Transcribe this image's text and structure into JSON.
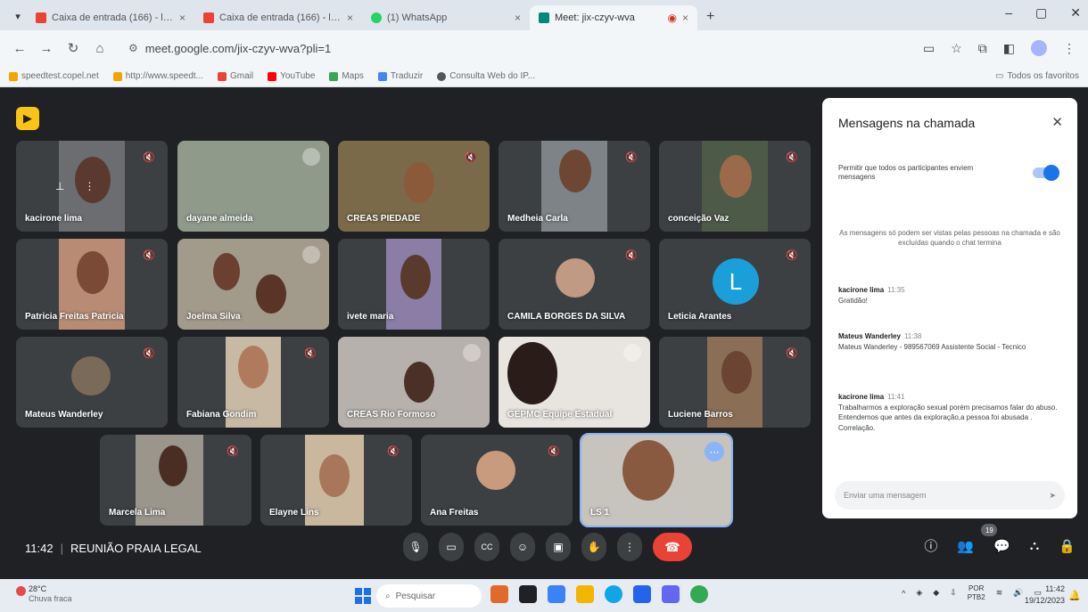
{
  "browser": {
    "tabs": [
      {
        "title": "Caixa de entrada (166) - ls1@...",
        "favicon_color": "#ea4335"
      },
      {
        "title": "Caixa de entrada (166) - ls1@...",
        "favicon_color": "#ea4335"
      },
      {
        "title": "(1) WhatsApp",
        "favicon_color": "#25d366"
      },
      {
        "title": "Meet: jix-czyv-wva",
        "favicon_color": "#00897b",
        "active": true
      }
    ],
    "url": "meet.google.com/jix-czyv-wva?pli=1",
    "bookmarks": [
      {
        "label": "speedtest.copel.net",
        "color": "#f4a300"
      },
      {
        "label": "http://www.speedt...",
        "color": "#f4a300"
      },
      {
        "label": "Gmail",
        "color": "#ea4335"
      },
      {
        "label": "YouTube",
        "color": "#ff0000"
      },
      {
        "label": "Maps",
        "color": "#34a853"
      },
      {
        "label": "Traduzir",
        "color": "#4285f4"
      },
      {
        "label": "Consulta Web do IP...",
        "color": "#555555"
      }
    ],
    "all_bookmarks": "Todos os favoritos"
  },
  "meet": {
    "participants": [
      {
        "name": "kacirone lima",
        "bg": "#6b6d70",
        "face": "#5a3a2e",
        "muted": true
      },
      {
        "name": "dayane almeida",
        "bg": "#8f9a8a",
        "face": "#b8a99a",
        "muted": true
      },
      {
        "name": "CREAS PIEDADE",
        "bg": "#7a6a4a",
        "face": "#8a5a3a",
        "muted": true
      },
      {
        "name": "Medheia Carla",
        "bg": "#7d8386",
        "face": "#6e4634",
        "muted": true
      },
      {
        "name": "conceição Vaz",
        "bg": "#4e5a48",
        "face": "#9a6a4a",
        "muted": true
      },
      {
        "name": "Patricia Freitas Patricia",
        "bg": "#b88c74",
        "face": "#7a4a36",
        "muted": true
      },
      {
        "name": "Joelma Silva",
        "bg": "#a29a8a",
        "face": "#6b4030",
        "muted": true
      },
      {
        "name": "ivete maria",
        "bg": "#8a7ea6",
        "face": "#5b3a2e",
        "muted": false
      },
      {
        "name": "CAMILA BORGES DA SILVA",
        "bg": "#3c4043",
        "face": "#c19a84",
        "muted": true
      },
      {
        "name": "Leticia Arantes",
        "bg": "#3c4043",
        "face": "",
        "muted": true,
        "initial": "L"
      },
      {
        "name": "Mateus Wanderley",
        "bg": "#3c4043",
        "face": "#7a6a5a",
        "muted": true
      },
      {
        "name": "Fabiana Gondim",
        "bg": "#c7b9a4",
        "face": "#b07a5e",
        "muted": true
      },
      {
        "name": "CREAS Rio Formoso",
        "bg": "#b6b1ad",
        "face": "#4a3026",
        "muted": false
      },
      {
        "name": "GEPMC Equipe Estadual",
        "bg": "#e8e4e0",
        "face": "#2a1c18",
        "muted": false
      },
      {
        "name": "Luciene Barros",
        "bg": "#8a6e56",
        "face": "#6b4434",
        "muted": true
      },
      {
        "name": "Marcela Lima",
        "bg": "#9a968c",
        "face": "#4a2e24",
        "muted": true
      },
      {
        "name": "Elayne Lins",
        "bg": "#c9b89e",
        "face": "#a8765a",
        "muted": true
      },
      {
        "name": "Ana Freitas",
        "bg": "#4a4d50",
        "face": "#c89a7e",
        "muted": true
      },
      {
        "name": "LS 1",
        "bg": "#c7c3bd",
        "face": "#8a5a40",
        "muted": false,
        "speaking": true
      }
    ],
    "time": "11:42",
    "meeting_name": "REUNIÃO PRAIA LEGAL",
    "participant_count": "19",
    "icons": {
      "mic": "🎙",
      "camera": "▭",
      "captions": "CC",
      "emoji": "☺",
      "present": "▣",
      "hand": "✋",
      "more": "⋮",
      "hangup": "☎",
      "info": "ⓘ",
      "people": "👥",
      "chat": "💬",
      "activities": "⛬",
      "host": "🔒",
      "muted": "🔇"
    }
  },
  "chat": {
    "title": "Mensagens na chamada",
    "permission": "Permitir que todos os participantes enviem mensagens",
    "notice": "As mensagens só podem ser vistas pelas pessoas na chamada e são excluídas quando o chat termina",
    "messages": [
      {
        "who": "kacirone lima",
        "time": "11:35",
        "text": "Gratidão!"
      },
      {
        "who": "Mateus Wanderley",
        "time": "11:38",
        "text": "Mateus Wanderley - 989567069 Assistente Social - Tecnico"
      },
      {
        "who": "kacirone lima",
        "time": "11:41",
        "text": "Trabalharmos a exploração sexual porém precisamos falar do abuso. Entendemos que antes da exploração,a pessoa foi abusada . Correlação."
      }
    ],
    "input_placeholder": "Enviar uma mensagem"
  },
  "taskbar": {
    "temp": "28°C",
    "condition": "Chuva fraca",
    "search": "Pesquisar",
    "lang1": "POR",
    "lang2": "PTB2",
    "clock_time": "11:42",
    "clock_date": "19/12/2023",
    "app_colors": [
      "#e06a2c",
      "#202124",
      "#3b82f6",
      "#f5b400",
      "#0ea5e9",
      "#2563eb",
      "#6366f1",
      "#34a853"
    ]
  }
}
